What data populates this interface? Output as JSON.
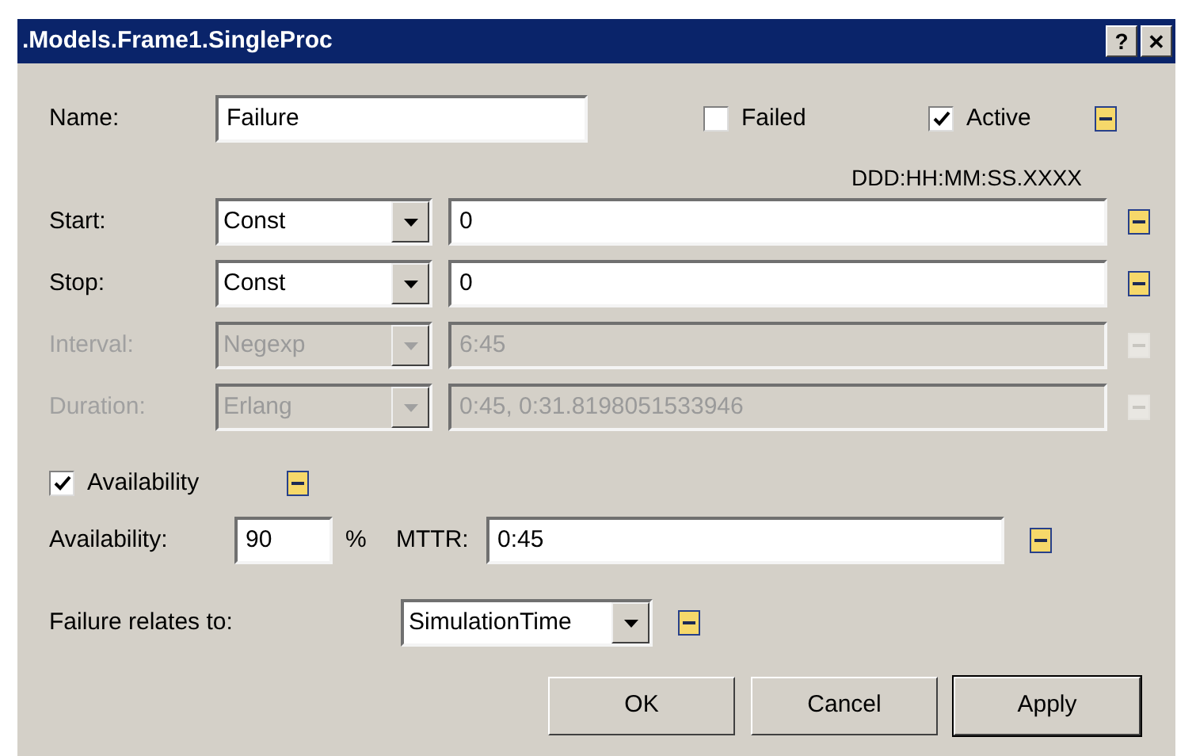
{
  "window": {
    "title": ".Models.Frame1.SingleProc",
    "help": "?",
    "close": "✕"
  },
  "name": {
    "label": "Name:",
    "value": "Failure"
  },
  "failed": {
    "label": "Failed",
    "checked": false
  },
  "active": {
    "label": "Active",
    "checked": true
  },
  "time_format": "DDD:HH:MM:SS.XXXX",
  "rows": [
    {
      "label": "Start:",
      "distribution": "Const",
      "value": "0",
      "disabled": false
    },
    {
      "label": "Stop:",
      "distribution": "Const",
      "value": "0",
      "disabled": false
    },
    {
      "label": "Interval:",
      "distribution": "Negexp",
      "value": "6:45",
      "disabled": true
    },
    {
      "label": "Duration:",
      "distribution": "Erlang",
      "value": "0:45, 0:31.8198051533946",
      "disabled": true
    }
  ],
  "availability_toggle": {
    "label": "Availability",
    "checked": true
  },
  "availability": {
    "label": "Availability:",
    "value": "90",
    "unit": "%"
  },
  "mttr": {
    "label": "MTTR:",
    "value": "0:45"
  },
  "relates": {
    "label": "Failure relates to:",
    "value": "SimulationTime"
  },
  "buttons": [
    {
      "label": "OK",
      "default": false
    },
    {
      "label": "Cancel",
      "default": false
    },
    {
      "label": "Apply",
      "default": true
    }
  ]
}
